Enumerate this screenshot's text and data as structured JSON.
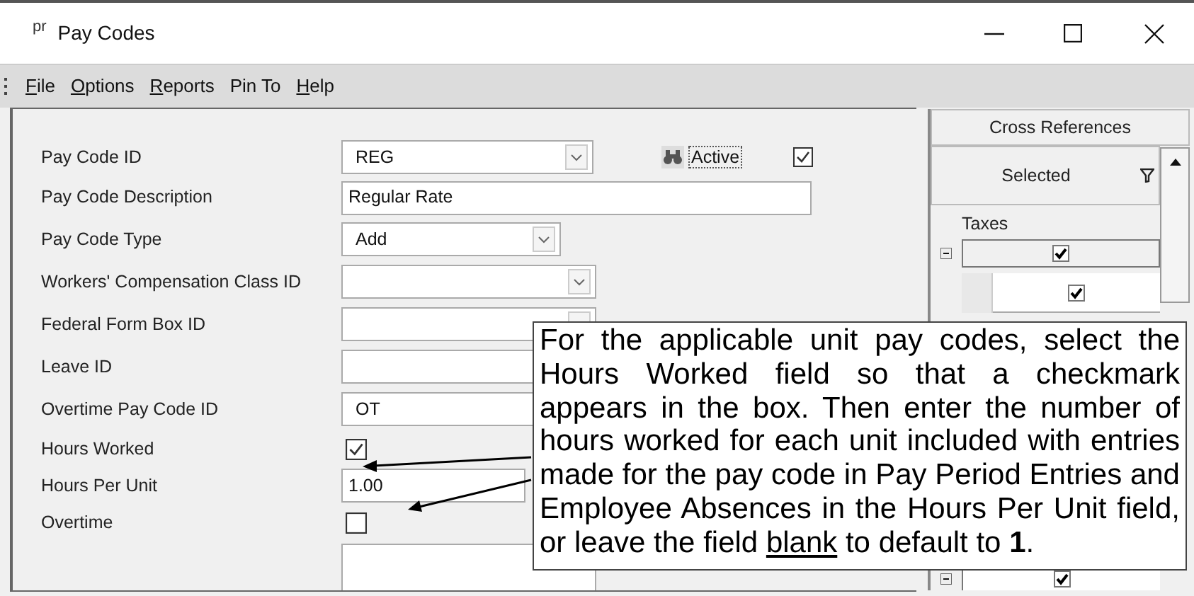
{
  "window": {
    "title": "Pay Codes",
    "app_icon": "pr"
  },
  "menu": [
    {
      "label": "File",
      "access_key": true
    },
    {
      "label": "Options",
      "access_key": true
    },
    {
      "label": "Reports",
      "access_key": true
    },
    {
      "label": "Pin To",
      "access_key": false
    },
    {
      "label": "Help",
      "access_key": true
    }
  ],
  "fields": [
    {
      "kind": "combo",
      "label": "Pay Code ID",
      "value": "REG"
    },
    {
      "kind": "text",
      "label": "Pay Code Description",
      "value": "Regular Rate"
    },
    {
      "kind": "combo",
      "label": "Pay Code Type",
      "value": "Add"
    },
    {
      "kind": "combo",
      "label": "Workers' Compensation Class ID"
    },
    {
      "kind": "combo",
      "label": "Federal Form Box ID"
    },
    {
      "kind": "text",
      "label": "Leave ID"
    },
    {
      "kind": "text",
      "label": "Overtime Pay Code ID",
      "value": "OT"
    },
    {
      "kind": "checkbox",
      "label": "Hours Worked",
      "checked": true
    },
    {
      "kind": "text",
      "label": "Hours Per Unit",
      "value": "1.00"
    },
    {
      "kind": "checkbox",
      "label": "Overtime",
      "checked": false
    },
    {
      "kind": "textarea"
    }
  ],
  "active": {
    "label": "Active",
    "checked": true
  },
  "cross_references": {
    "title": "Cross References",
    "filter": "Selected",
    "group": "Taxes",
    "expanded": true,
    "group_checked": true,
    "rows": [
      {
        "checked": true
      }
    ],
    "next_group": {
      "expanded": true,
      "checked": true
    }
  },
  "callout": {
    "parts": [
      {
        "text": "For the applicable unit pay codes, select the Hours Worked field so that a checkmark appears in the box. Then enter the number of hours worked for each unit included with entries made for the pay code in Pay Period Entries and Employee Absences in the Hours Per Unit field, or leave the field ",
        "underline": false
      },
      {
        "text": "blank",
        "underline": true
      },
      {
        "text": " to default to **1**.",
        "underline": false
      }
    ]
  }
}
